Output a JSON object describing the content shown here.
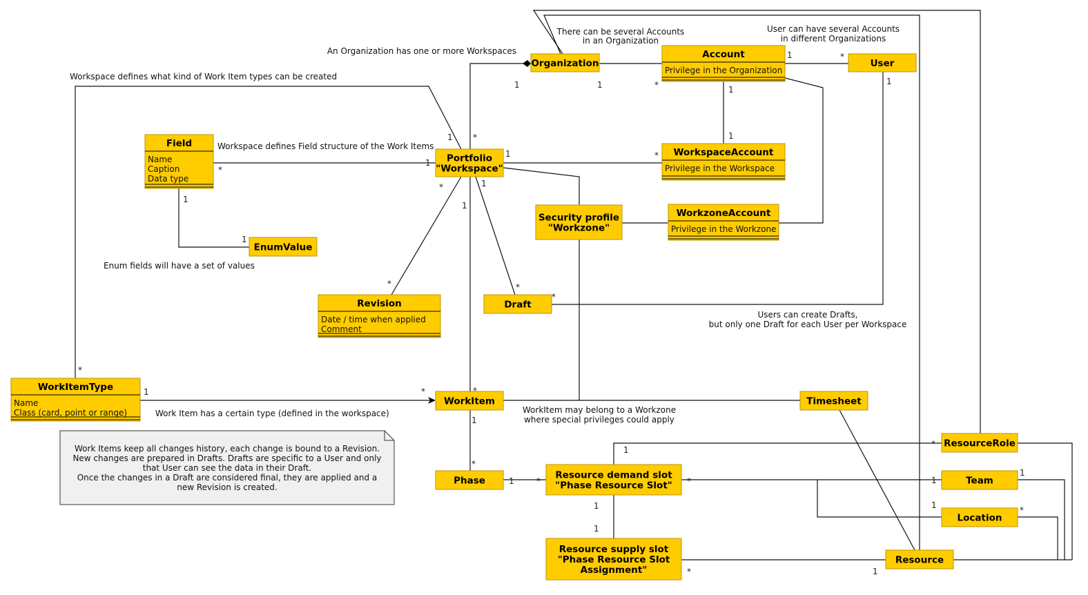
{
  "colors": {
    "class_fill": "#ffcc00",
    "note_fill": "#f0f0f0"
  },
  "classes": [
    {
      "id": "organization",
      "name": [
        "Organization"
      ],
      "attrs": []
    },
    {
      "id": "account",
      "name": [
        "Account"
      ],
      "attrs": [
        "Privilege in the Organization"
      ]
    },
    {
      "id": "user",
      "name": [
        "User"
      ],
      "attrs": []
    },
    {
      "id": "field",
      "name": [
        "Field"
      ],
      "attrs": [
        "Name",
        "Caption",
        "Data type"
      ]
    },
    {
      "id": "workspace",
      "name": [
        "Portfolio",
        "\"Workspace\""
      ],
      "attrs": []
    },
    {
      "id": "workspace-account",
      "name": [
        "WorkspaceAccount"
      ],
      "attrs": [
        "Privilege in the Workspace"
      ]
    },
    {
      "id": "security-profile",
      "name": [
        "Security profile",
        "\"Workzone\""
      ],
      "attrs": []
    },
    {
      "id": "workzone-account",
      "name": [
        "WorkzoneAccount"
      ],
      "attrs": [
        "Privilege in the Workzone"
      ]
    },
    {
      "id": "enum-value",
      "name": [
        "EnumValue"
      ],
      "attrs": []
    },
    {
      "id": "revision",
      "name": [
        "Revision"
      ],
      "attrs": [
        "Date / time when applied",
        "Comment"
      ]
    },
    {
      "id": "draft",
      "name": [
        "Draft"
      ],
      "attrs": []
    },
    {
      "id": "work-item-type",
      "name": [
        "WorkItemType"
      ],
      "attrs": [
        "Name",
        "Class (card, point or range)"
      ]
    },
    {
      "id": "work-item",
      "name": [
        "WorkItem"
      ],
      "attrs": []
    },
    {
      "id": "timesheet",
      "name": [
        "Timesheet"
      ],
      "attrs": []
    },
    {
      "id": "resource-role",
      "name": [
        "ResourceRole"
      ],
      "attrs": []
    },
    {
      "id": "phase",
      "name": [
        "Phase"
      ],
      "attrs": []
    },
    {
      "id": "resource-demand-slot",
      "name": [
        "Resource demand slot",
        "\"Phase Resource Slot\""
      ],
      "attrs": []
    },
    {
      "id": "team",
      "name": [
        "Team"
      ],
      "attrs": []
    },
    {
      "id": "location",
      "name": [
        "Location"
      ],
      "attrs": []
    },
    {
      "id": "resource-supply-slot",
      "name": [
        "Resource supply slot",
        "\"Phase Resource Slot",
        "Assignment\""
      ],
      "attrs": []
    },
    {
      "id": "resource",
      "name": [
        "Resource"
      ],
      "attrs": []
    }
  ],
  "annotations": [
    "There can be several Accounts",
    "in an Organization",
    "User can have several Accounts",
    "in different Organizations",
    "An Organization has one or more Workspaces",
    "Workspace defines what kind of Work Item types can be created",
    "Workspace defines Field structure of the Work Items",
    "Enum fields will have a set of values",
    "Users can create Drafts,",
    "but only one Draft for each User per Workspace",
    "Work Item has a certain type (defined in the workspace)",
    "WorkItem may belong to a Workzone",
    "where special privileges could apply"
  ],
  "note": [
    "Work Items keep all changes history, each change is bound to a Revision.",
    "New changes are prepared in Drafts. Drafts are specific to a User and only",
    "that User can see the data in their Draft.",
    "Once the changes in a Draft are considered final, they are applied and a",
    "new Revision is created."
  ],
  "multiplicities": [
    "1",
    "1",
    "*",
    "*",
    "1",
    "1",
    "1",
    "*",
    "1",
    "*",
    "1",
    "*",
    "1",
    "*",
    "1",
    "1",
    "1",
    "*",
    "*",
    "*",
    "1",
    "*",
    "1",
    "*",
    "1",
    "*",
    "1",
    "*",
    "1",
    "*",
    "1",
    "*",
    "1",
    "1",
    "1",
    "1",
    "*",
    "1",
    "*",
    "1",
    "*"
  ]
}
